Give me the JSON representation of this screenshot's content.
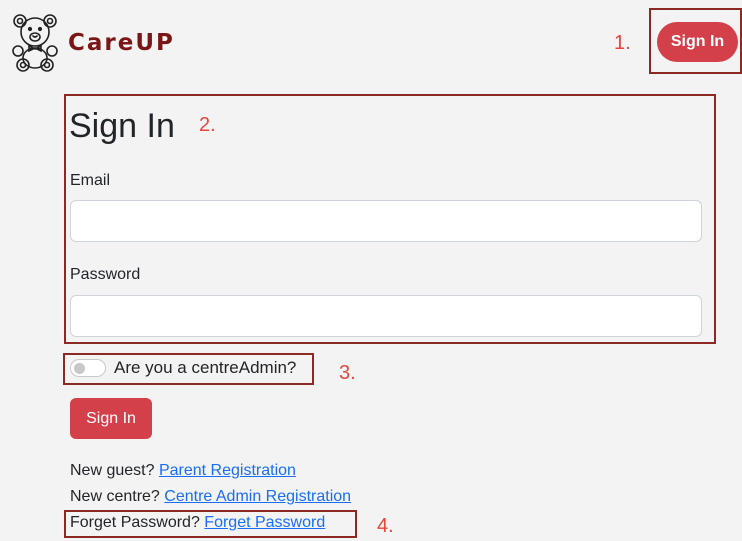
{
  "header": {
    "brand": "CareUP",
    "logo_icon": "teddy-bear-icon",
    "signin_label": "Sign In",
    "brand_color": "#7a1616",
    "accent_color": "#d3404a"
  },
  "annotations": {
    "one": "1.",
    "two": "2.",
    "three": "3.",
    "four": "4."
  },
  "form": {
    "title": "Sign In",
    "email_label": "Email",
    "email_value": "",
    "email_placeholder": "",
    "password_label": "Password",
    "password_value": "",
    "password_placeholder": "",
    "admin_toggle_label": "Are you a centreAdmin?",
    "admin_toggle_on": false,
    "submit_label": "Sign In"
  },
  "links": {
    "guest_prefix": "New guest?",
    "guest_link": "Parent Registration",
    "centre_prefix": "New centre?",
    "centre_link": "Centre Admin Registration",
    "forget_prefix": "Forget Password?",
    "forget_link": "Forget Password",
    "link_color": "#1a6ef5"
  }
}
